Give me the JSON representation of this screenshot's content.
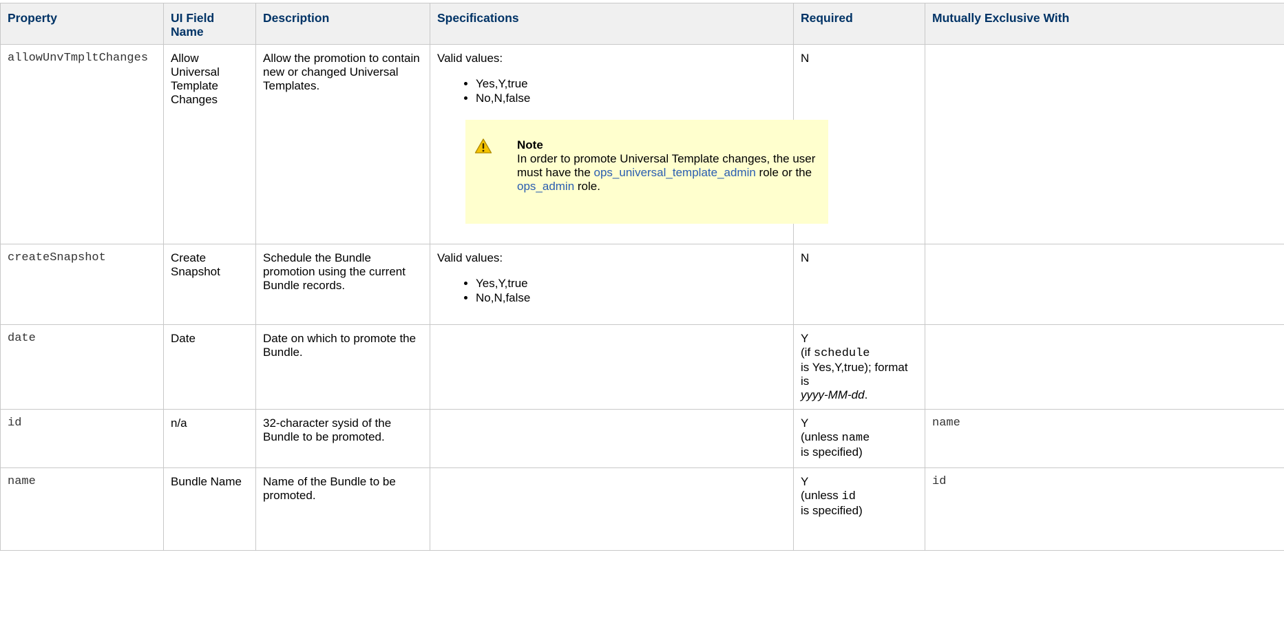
{
  "columns": [
    "Property",
    "UI Field Name",
    "Description",
    "Specifications",
    "Required",
    "Mutually Exclusive With"
  ],
  "rows": [
    {
      "property": "allowUnvTmpltChanges",
      "ui_field": "Allow Universal Template Changes",
      "description": "Allow the promotion to contain new or changed Universal Templates.",
      "spec_intro": "Valid values:",
      "spec_values": [
        "Yes,Y,true",
        "No,N,false"
      ],
      "note": {
        "icon": "warning-icon",
        "title": "Note",
        "body_before": "In order to promote Universal Template changes, the user must have the ",
        "link1": "ops_universal_template_admin",
        "between": " role or the ",
        "link2": "ops_admin",
        "after": " role."
      },
      "required": "N",
      "exclusive": ""
    },
    {
      "property": "createSnapshot",
      "ui_field": "Create Snapshot",
      "description": "Schedule the Bundle promotion using the current Bundle records.",
      "spec_intro": "Valid values:",
      "spec_values": [
        "Yes,Y,true",
        "No,N,false"
      ],
      "required": "N",
      "exclusive": ""
    },
    {
      "property": "date",
      "ui_field": "Date",
      "description": "Date on which to promote the Bundle.",
      "required_head": "Y",
      "required_open": "(if ",
      "required_code": "schedule",
      "required_mid": "is Yes,Y,true); format is",
      "required_fmt": "yyyy-MM-dd",
      "required_end": ".",
      "exclusive": ""
    },
    {
      "property": "id",
      "ui_field": "n/a",
      "description": "32-character sysid of the Bundle to be promoted.",
      "required_head": "Y",
      "required_open": "(unless ",
      "required_code": "name",
      "required_tail": "is specified)",
      "exclusive": "name"
    },
    {
      "property": "name",
      "ui_field": "Bundle Name",
      "description": "Name of the Bundle to be promoted.",
      "required_head": "Y",
      "required_open": "(unless ",
      "required_code": "id",
      "required_tail": "is specified)",
      "exclusive": "id"
    }
  ]
}
